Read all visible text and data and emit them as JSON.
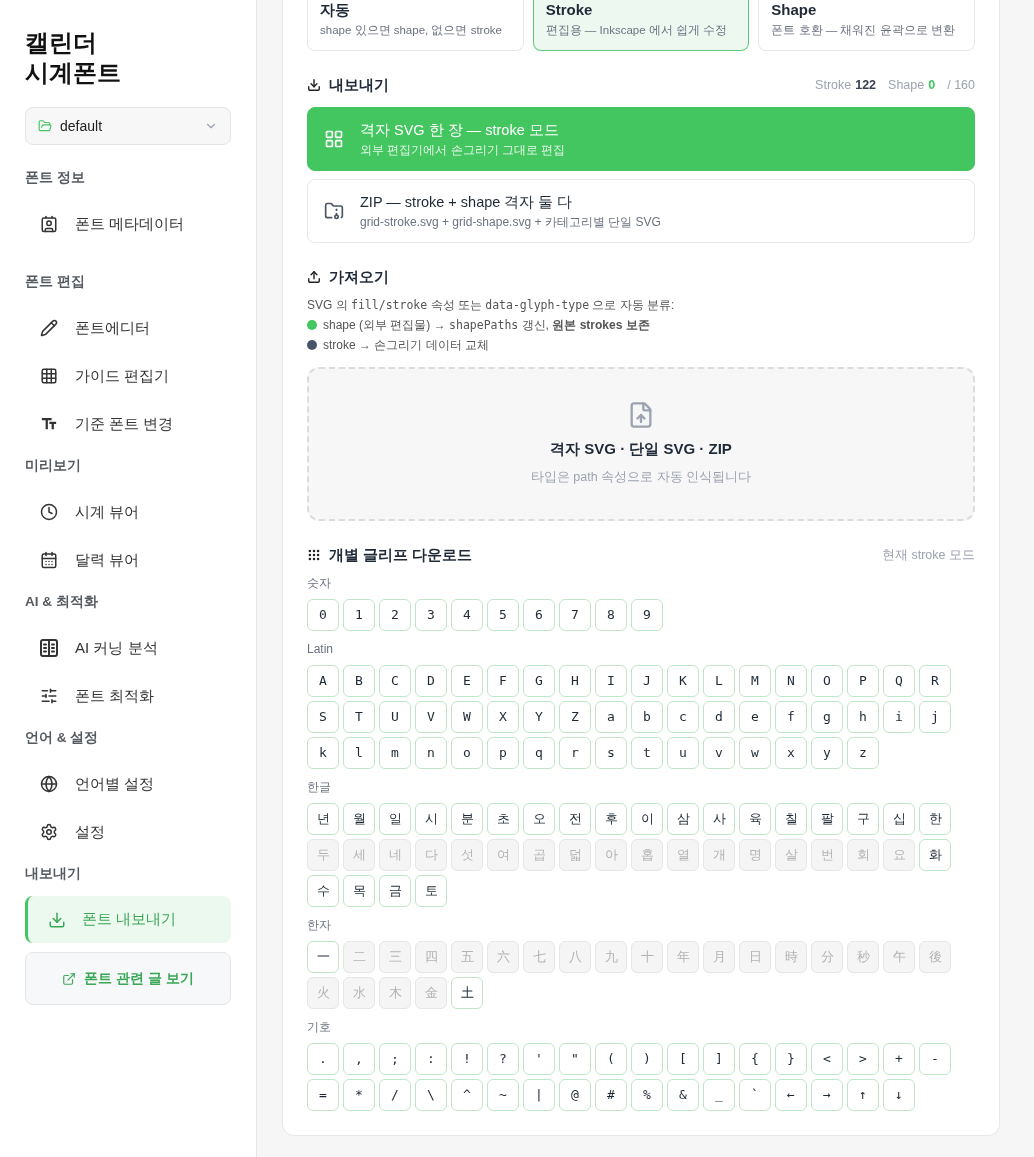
{
  "sidebar": {
    "title_lines": [
      "캘린더",
      "시계폰트"
    ],
    "project_select": {
      "value": "default"
    },
    "groups": [
      {
        "label": "폰트 정보",
        "items": [
          {
            "label": "폰트 메타데이터",
            "selected": false
          }
        ]
      },
      {
        "label": "폰트 편집",
        "items": [
          {
            "label": "폰트에디터",
            "selected": false
          },
          {
            "label": "가이드 편집기",
            "selected": false
          },
          {
            "label": "기준 폰트 변경",
            "selected": false
          }
        ]
      },
      {
        "label": "미리보기",
        "items": [
          {
            "label": "시계 뷰어",
            "selected": false
          },
          {
            "label": "달력 뷰어",
            "selected": false
          }
        ]
      },
      {
        "label": "AI & 최적화",
        "items": [
          {
            "label": "AI 커닝 분석",
            "selected": false
          },
          {
            "label": "폰트 최적화",
            "selected": false
          }
        ]
      },
      {
        "label": "언어 & 설정",
        "items": [
          {
            "label": "언어별 설정",
            "selected": false
          },
          {
            "label": "설정",
            "selected": false
          }
        ]
      },
      {
        "label": "내보내기",
        "items": [
          {
            "label": "폰트 내보내기",
            "selected": true
          }
        ]
      }
    ],
    "link_button": "폰트 관련 글 보기"
  },
  "mode_cards": [
    {
      "title": "자동",
      "description": "shape 있으면 shape, 없으면 stroke",
      "selected": false
    },
    {
      "title": "Stroke",
      "description": "편집용 — Inkscape 에서 쉽게 수정",
      "selected": true
    },
    {
      "title": "Shape",
      "description": "폰트 호환 — 채워진 윤곽으로 변환",
      "selected": false
    }
  ],
  "export": {
    "title": "내보내기",
    "counts": [
      {
        "label": "Stroke",
        "value": "122",
        "color": "#374151"
      },
      {
        "label": "Shape",
        "value": "0",
        "color": "#43c55f"
      }
    ],
    "total": "/ 160",
    "options": [
      {
        "title": "격자 SVG 한 장 — stroke 모드",
        "description": "외부 편집기에서 손그리기 그대로 편집",
        "selected": true
      },
      {
        "title": "ZIP — stroke + shape 격자 둘 다",
        "description": "grid-stroke.svg + grid-shape.svg + 카테고리별 단일 SVG",
        "selected": false
      }
    ]
  },
  "import": {
    "title": "가져오기",
    "note": [
      {
        "kind": "text",
        "text": "SVG 의 "
      },
      {
        "kind": "code",
        "text": "fill/stroke"
      },
      {
        "kind": "text",
        "text": " 속성 또는 "
      },
      {
        "kind": "code",
        "text": "data-glyph-type"
      },
      {
        "kind": "text",
        "text": " 으로 자동 분류:"
      }
    ],
    "legend": [
      {
        "color": "#43c55f",
        "parts": [
          {
            "kind": "text",
            "text": "shape (외부 편집물) → "
          },
          {
            "kind": "code",
            "text": "shapePaths"
          },
          {
            "kind": "text",
            "text": " 갱신, **원본 strokes 보존**"
          }
        ]
      },
      {
        "color": "#475569",
        "parts": [
          {
            "kind": "text",
            "text": "stroke → 손그리기 데이터 교체"
          }
        ]
      }
    ],
    "dropzone": {
      "title": "격자 SVG · 단일 SVG · ZIP",
      "hint": "타입은 path 속성으로 자동 인식됩니다"
    }
  },
  "glyph_download": {
    "title": "개별 글리프 다운로드",
    "mode_note": "현재 stroke 모드",
    "groups": [
      {
        "label": "숫자",
        "glyphs": [
          {
            "char": "0",
            "disabled": false
          },
          {
            "char": "1",
            "disabled": false
          },
          {
            "char": "2",
            "disabled": false
          },
          {
            "char": "3",
            "disabled": false
          },
          {
            "char": "4",
            "disabled": false
          },
          {
            "char": "5",
            "disabled": false
          },
          {
            "char": "6",
            "disabled": false
          },
          {
            "char": "7",
            "disabled": false
          },
          {
            "char": "8",
            "disabled": false
          },
          {
            "char": "9",
            "disabled": false
          }
        ]
      },
      {
        "label": "Latin",
        "glyphs": [
          {
            "char": "A",
            "disabled": false
          },
          {
            "char": "B",
            "disabled": false
          },
          {
            "char": "C",
            "disabled": false
          },
          {
            "char": "D",
            "disabled": false
          },
          {
            "char": "E",
            "disabled": false
          },
          {
            "char": "F",
            "disabled": false
          },
          {
            "char": "G",
            "disabled": false
          },
          {
            "char": "H",
            "disabled": false
          },
          {
            "char": "I",
            "disabled": false
          },
          {
            "char": "J",
            "disabled": false
          },
          {
            "char": "K",
            "disabled": false
          },
          {
            "char": "L",
            "disabled": false
          },
          {
            "char": "M",
            "disabled": false
          },
          {
            "char": "N",
            "disabled": false
          },
          {
            "char": "O",
            "disabled": false
          },
          {
            "char": "P",
            "disabled": false
          },
          {
            "char": "Q",
            "disabled": false
          },
          {
            "char": "R",
            "disabled": false
          },
          {
            "char": "S",
            "disabled": false
          },
          {
            "char": "T",
            "disabled": false
          },
          {
            "char": "U",
            "disabled": false
          },
          {
            "char": "V",
            "disabled": false
          },
          {
            "char": "W",
            "disabled": false
          },
          {
            "char": "X",
            "disabled": false
          },
          {
            "char": "Y",
            "disabled": false
          },
          {
            "char": "Z",
            "disabled": false
          },
          {
            "char": "a",
            "disabled": false
          },
          {
            "char": "b",
            "disabled": false
          },
          {
            "char": "c",
            "disabled": false
          },
          {
            "char": "d",
            "disabled": false
          },
          {
            "char": "e",
            "disabled": false
          },
          {
            "char": "f",
            "disabled": false
          },
          {
            "char": "g",
            "disabled": false
          },
          {
            "char": "h",
            "disabled": false
          },
          {
            "char": "i",
            "disabled": false
          },
          {
            "char": "j",
            "disabled": false
          },
          {
            "char": "k",
            "disabled": false
          },
          {
            "char": "l",
            "disabled": false
          },
          {
            "char": "m",
            "disabled": false
          },
          {
            "char": "n",
            "disabled": false
          },
          {
            "char": "o",
            "disabled": false
          },
          {
            "char": "p",
            "disabled": false
          },
          {
            "char": "q",
            "disabled": false
          },
          {
            "char": "r",
            "disabled": false
          },
          {
            "char": "s",
            "disabled": false
          },
          {
            "char": "t",
            "disabled": false
          },
          {
            "char": "u",
            "disabled": false
          },
          {
            "char": "v",
            "disabled": false
          },
          {
            "char": "w",
            "disabled": false
          },
          {
            "char": "x",
            "disabled": false
          },
          {
            "char": "y",
            "disabled": false
          },
          {
            "char": "z",
            "disabled": false
          }
        ]
      },
      {
        "label": "한글",
        "glyphs": [
          {
            "char": "년",
            "disabled": false
          },
          {
            "char": "월",
            "disabled": false
          },
          {
            "char": "일",
            "disabled": false
          },
          {
            "char": "시",
            "disabled": false
          },
          {
            "char": "분",
            "disabled": false
          },
          {
            "char": "초",
            "disabled": false
          },
          {
            "char": "오",
            "disabled": false
          },
          {
            "char": "전",
            "disabled": false
          },
          {
            "char": "후",
            "disabled": false
          },
          {
            "char": "이",
            "disabled": false
          },
          {
            "char": "삼",
            "disabled": false
          },
          {
            "char": "사",
            "disabled": false
          },
          {
            "char": "육",
            "disabled": false
          },
          {
            "char": "칠",
            "disabled": false
          },
          {
            "char": "팔",
            "disabled": false
          },
          {
            "char": "구",
            "disabled": false
          },
          {
            "char": "십",
            "disabled": false
          },
          {
            "char": "한",
            "disabled": false
          },
          {
            "char": "두",
            "disabled": true
          },
          {
            "char": "세",
            "disabled": true
          },
          {
            "char": "네",
            "disabled": true
          },
          {
            "char": "다",
            "disabled": true
          },
          {
            "char": "섯",
            "disabled": true
          },
          {
            "char": "여",
            "disabled": true
          },
          {
            "char": "곱",
            "disabled": true
          },
          {
            "char": "덟",
            "disabled": true
          },
          {
            "char": "아",
            "disabled": true
          },
          {
            "char": "홉",
            "disabled": true
          },
          {
            "char": "열",
            "disabled": true
          },
          {
            "char": "개",
            "disabled": true
          },
          {
            "char": "명",
            "disabled": true
          },
          {
            "char": "살",
            "disabled": true
          },
          {
            "char": "번",
            "disabled": true
          },
          {
            "char": "회",
            "disabled": true
          },
          {
            "char": "요",
            "disabled": true
          },
          {
            "char": "화",
            "disabled": false
          },
          {
            "char": "수",
            "disabled": false
          },
          {
            "char": "목",
            "disabled": false
          },
          {
            "char": "금",
            "disabled": false
          },
          {
            "char": "토",
            "disabled": false
          }
        ]
      },
      {
        "label": "한자",
        "glyphs": [
          {
            "char": "一",
            "disabled": false
          },
          {
            "char": "二",
            "disabled": true
          },
          {
            "char": "三",
            "disabled": true
          },
          {
            "char": "四",
            "disabled": true
          },
          {
            "char": "五",
            "disabled": true
          },
          {
            "char": "六",
            "disabled": true
          },
          {
            "char": "七",
            "disabled": true
          },
          {
            "char": "八",
            "disabled": true
          },
          {
            "char": "九",
            "disabled": true
          },
          {
            "char": "十",
            "disabled": true
          },
          {
            "char": "年",
            "disabled": true
          },
          {
            "char": "月",
            "disabled": true
          },
          {
            "char": "日",
            "disabled": true
          },
          {
            "char": "時",
            "disabled": true
          },
          {
            "char": "分",
            "disabled": true
          },
          {
            "char": "秒",
            "disabled": true
          },
          {
            "char": "午",
            "disabled": true
          },
          {
            "char": "後",
            "disabled": true
          },
          {
            "char": "火",
            "disabled": true
          },
          {
            "char": "水",
            "disabled": true
          },
          {
            "char": "木",
            "disabled": true
          },
          {
            "char": "金",
            "disabled": true
          },
          {
            "char": "土",
            "disabled": false
          }
        ]
      },
      {
        "label": "기호",
        "glyphs": [
          {
            "char": ".",
            "disabled": false
          },
          {
            "char": ",",
            "disabled": false
          },
          {
            "char": ";",
            "disabled": false
          },
          {
            "char": ":",
            "disabled": false
          },
          {
            "char": "!",
            "disabled": false
          },
          {
            "char": "?",
            "disabled": false
          },
          {
            "char": "'",
            "disabled": false
          },
          {
            "char": "\"",
            "disabled": false
          },
          {
            "char": "(",
            "disabled": false
          },
          {
            "char": ")",
            "disabled": false
          },
          {
            "char": "[",
            "disabled": false
          },
          {
            "char": "]",
            "disabled": false
          },
          {
            "char": "{",
            "disabled": false
          },
          {
            "char": "}",
            "disabled": false
          },
          {
            "char": "<",
            "disabled": false
          },
          {
            "char": ">",
            "disabled": false
          },
          {
            "char": "+",
            "disabled": false
          },
          {
            "char": "-",
            "disabled": false
          },
          {
            "char": "=",
            "disabled": false
          },
          {
            "char": "*",
            "disabled": false
          },
          {
            "char": "/",
            "disabled": false
          },
          {
            "char": "\\",
            "disabled": false
          },
          {
            "char": "^",
            "disabled": false
          },
          {
            "char": "~",
            "disabled": false
          },
          {
            "char": "|",
            "disabled": false
          },
          {
            "char": "@",
            "disabled": false
          },
          {
            "char": "#",
            "disabled": false
          },
          {
            "char": "%",
            "disabled": false
          },
          {
            "char": "&",
            "disabled": false
          },
          {
            "char": "_",
            "disabled": false
          },
          {
            "char": "`",
            "disabled": false
          },
          {
            "char": "←",
            "disabled": false
          },
          {
            "char": "→",
            "disabled": false
          },
          {
            "char": "↑",
            "disabled": false
          },
          {
            "char": "↓",
            "disabled": false
          }
        ]
      }
    ]
  }
}
